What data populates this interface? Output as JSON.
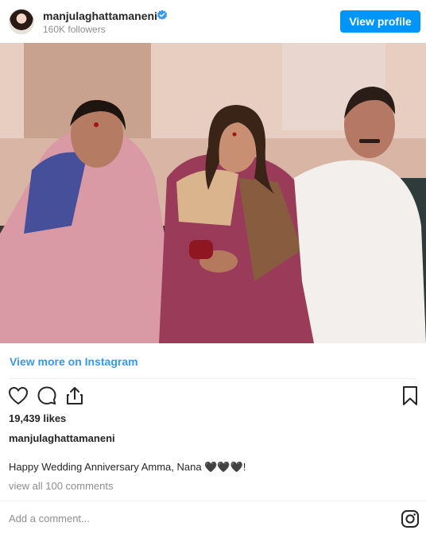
{
  "post": {
    "username": "manjulaghattamaneni",
    "followers": "160K followers",
    "view_profile_label": "View profile",
    "view_more_label": "View more on Instagram",
    "likes": "19,439 likes",
    "caption_author": "manjulaghattamaneni",
    "caption_text": "Happy Wedding Anniversary Amma, Nana 🖤🖤🖤!",
    "comments_link": "view all 100 comments",
    "comment_placeholder": "Add a comment..."
  },
  "colors": {
    "accent": "#0095f6",
    "link": "#3897f0",
    "muted": "#8e8e8e"
  },
  "icons": [
    "verified-badge-icon",
    "heart-icon",
    "comment-icon",
    "share-icon",
    "bookmark-icon",
    "instagram-icon"
  ]
}
